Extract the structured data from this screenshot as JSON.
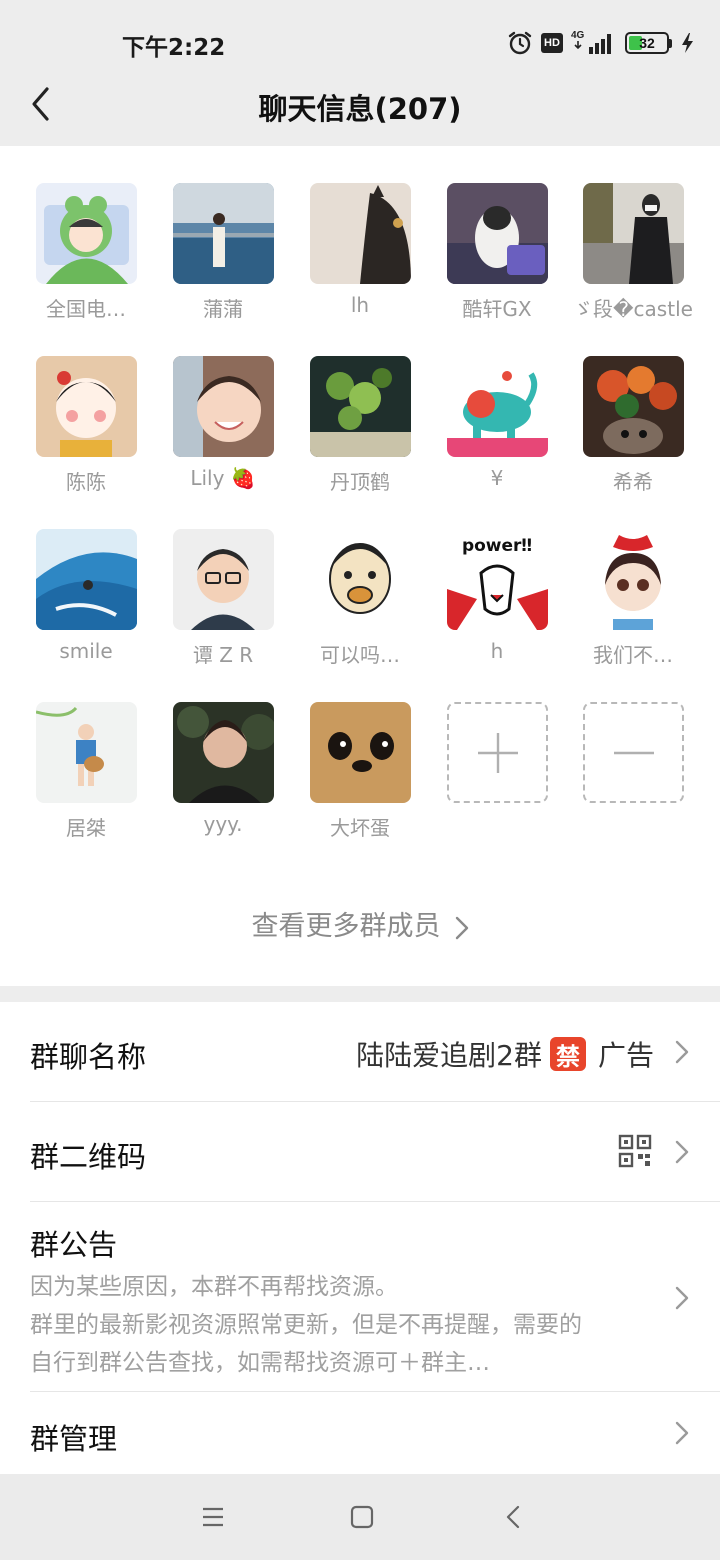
{
  "status": {
    "time": "下午2:22",
    "hd_label": "HD",
    "network": "4G",
    "battery": "32",
    "battery_level": 0.32
  },
  "header": {
    "title": "聊天信息(207)"
  },
  "members": [
    {
      "name": "全国电…"
    },
    {
      "name": "蒲蒲"
    },
    {
      "name": "lh"
    },
    {
      "name": "酷轩GX"
    },
    {
      "name": "ゞ段�castle"
    },
    {
      "name": "陈陈"
    },
    {
      "name": "Lily 🍓"
    },
    {
      "name": "丹顶鹤"
    },
    {
      "name": "¥"
    },
    {
      "name": "希希"
    },
    {
      "name": "smile"
    },
    {
      "name": "谭 Z R"
    },
    {
      "name": "可以吗…"
    },
    {
      "name": "h"
    },
    {
      "name": "我们不…"
    },
    {
      "name": "居桀"
    },
    {
      "name": "yyy."
    },
    {
      "name": "大坏蛋"
    }
  ],
  "more_members": "查看更多群成员",
  "settings": {
    "group_name_label": "群聊名称",
    "group_name_value": "陆陆爱追剧2群",
    "group_name_badge": "禁",
    "group_name_suffix": "广告",
    "qrcode_label": "群二维码",
    "notice_label": "群公告",
    "notice_line1": "因为某些原因，本群不再帮找资源。",
    "notice_line2": "群里的最新影视资源照常更新，但是不再提醒，需要的",
    "notice_line3": "自行到群公告查找，如需帮找资源可＋群主…",
    "manage_label": "群管理"
  },
  "colors": {
    "background": "#ededed",
    "card": "#ffffff",
    "muted_text": "#9a9a9a",
    "ban_badge": "#e8452b",
    "battery_fill": "#3ec24a"
  }
}
